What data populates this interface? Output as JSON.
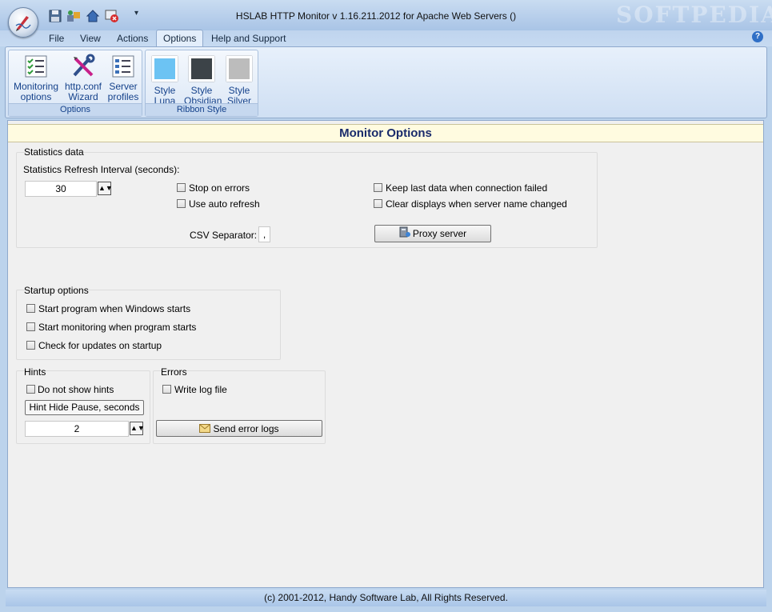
{
  "window": {
    "title": "HSLAB HTTP Monitor v 1.16.211.2012 for Apache Web Servers ()",
    "watermark": "SOFTPEDIA"
  },
  "menu": {
    "tabs": [
      "File",
      "View",
      "Actions",
      "Options",
      "Help and Support"
    ],
    "active_tab": "Options"
  },
  "ribbon": {
    "options_group": {
      "title": "Options",
      "buttons": [
        {
          "line1": "Monitoring",
          "line2": "options"
        },
        {
          "line1": "http.conf",
          "line2": "Wizard"
        },
        {
          "line1": "Server",
          "line2": "profiles"
        }
      ]
    },
    "style_group": {
      "title": "Ribbon Style",
      "buttons": [
        {
          "line1": "Style",
          "line2": "Luna",
          "color": "#6cc3f3"
        },
        {
          "line1": "Style",
          "line2": "Obsidian",
          "color": "#3c4348"
        },
        {
          "line1": "Style",
          "line2": "Silver",
          "color": "#bcbcbc"
        }
      ]
    }
  },
  "monitor_options": {
    "title": "Monitor Options",
    "statistics": {
      "legend": "Statistics data",
      "refresh_label": "Statistics Refresh Interval (seconds):",
      "refresh_value": "30",
      "stop_on_errors": "Stop on errors",
      "use_auto_refresh": "Use auto refresh",
      "keep_last_data": "Keep last data when connection failed",
      "clear_displays": "Clear displays when server name changed",
      "csv_label": "CSV Separator:",
      "csv_value": ",",
      "proxy_button": "Proxy server"
    },
    "startup": {
      "legend": "Startup options",
      "start_program": "Start program when Windows starts",
      "start_monitoring": "Start monitoring when program starts",
      "check_updates": "Check for updates on startup"
    },
    "hints": {
      "legend": "Hints",
      "do_not_show": "Do not show hints",
      "pause_button": "Hint Hide Pause, seconds",
      "pause_value": "2"
    },
    "errors": {
      "legend": "Errors",
      "write_log": "Write log file",
      "send_button": "Send error logs"
    }
  },
  "status": {
    "text": "(c) 2001-2012, Handy Software Lab, All Rights Reserved."
  }
}
